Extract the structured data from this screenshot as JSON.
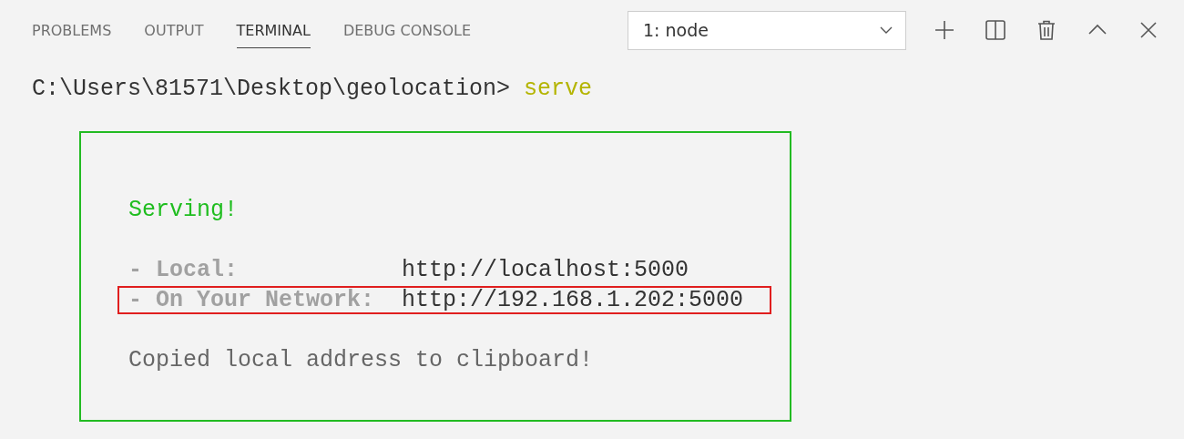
{
  "tabs": [
    {
      "label": "PROBLEMS",
      "selected": false
    },
    {
      "label": "OUTPUT",
      "selected": false
    },
    {
      "label": "TERMINAL",
      "selected": true
    },
    {
      "label": "DEBUG CONSOLE",
      "selected": false
    }
  ],
  "terminal_select": {
    "value": "1: node"
  },
  "toolbar": [
    {
      "kind": "plus"
    },
    {
      "kind": "split"
    },
    {
      "kind": "trash"
    },
    {
      "kind": "up"
    },
    {
      "kind": "close"
    }
  ],
  "prompt": {
    "path": "C:\\Users\\81571\\Desktop\\geolocation>",
    "command": "serve"
  },
  "serve_box": {
    "lines": [
      {
        "kind": "blank"
      },
      {
        "kind": "success",
        "text": "Serving!"
      },
      {
        "kind": "blank"
      },
      {
        "kind": "address",
        "label": "- Local:",
        "value": "http://localhost:5000",
        "highlighted": false
      },
      {
        "kind": "address",
        "label": "- On Your Network:",
        "value": "http://192.168.1.202:5000",
        "highlighted": true
      },
      {
        "kind": "blank"
      },
      {
        "kind": "info",
        "text": "Copied local address to clipboard!"
      },
      {
        "kind": "blank"
      }
    ]
  }
}
